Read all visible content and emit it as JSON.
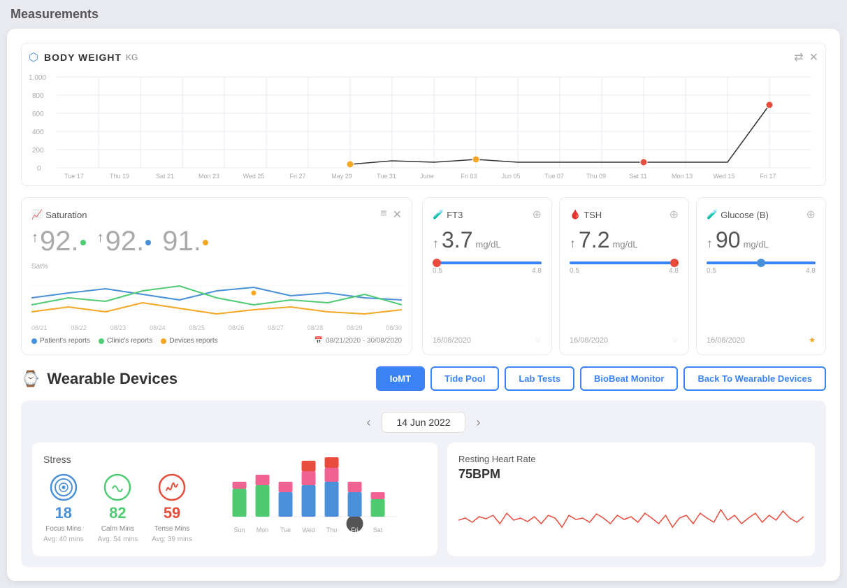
{
  "pageTitle": "Measurements",
  "bodyWeight": {
    "title": "BODY WEIGHT",
    "unit": "KG",
    "xLabels": [
      "Tue 17",
      "Thu 19",
      "Sat 21",
      "Mon 23",
      "Wed 25",
      "Fri 27",
      "May 29",
      "Tue 31",
      "June",
      "Fri 03",
      "Jun 05",
      "Tue 07",
      "Thu 09",
      "Sat 11",
      "Mon 13",
      "Wed 15",
      "Fri 17"
    ],
    "yLabels": [
      "1,000",
      "800",
      "600",
      "400",
      "200",
      "0"
    ]
  },
  "saturation": {
    "title": "Saturation",
    "values": [
      "92.",
      "92.",
      "91."
    ],
    "axisLabel": "Sat%",
    "legend": [
      {
        "label": "Patient's reports",
        "color": "#4a90d9"
      },
      {
        "label": "Clinic's reports",
        "color": "#4ecb71"
      },
      {
        "label": "Devices reports",
        "color": "#f5a623"
      }
    ],
    "dateRange": "08/21/2020 - 30/08/2020",
    "xLabels": [
      "08/21",
      "08/22",
      "08/23",
      "08/24",
      "08/25",
      "08/26",
      "08/27",
      "08/28",
      "08/29",
      "08/30"
    ]
  },
  "labCards": [
    {
      "id": "ft3",
      "icon": "🧪",
      "title": "FT3",
      "value": "3.7",
      "unit": "mg/dL",
      "sliderMin": "0.5",
      "sliderMax": "4.8",
      "thumbPos": "left",
      "date": "16/08/2020",
      "starred": false
    },
    {
      "id": "tsh",
      "icon": "🩸",
      "title": "TSH",
      "value": "7.2",
      "unit": "mg/dL",
      "sliderMin": "0.5",
      "sliderMax": "4.8",
      "thumbPos": "right",
      "date": "16/08/2020",
      "starred": false
    },
    {
      "id": "glucose",
      "icon": "🧪",
      "title": "Glucose (B)",
      "value": "90",
      "unit": "mg/dL",
      "sliderMin": "0.5",
      "sliderMax": "4.8",
      "thumbPos": "middle",
      "date": "16/08/2020",
      "starred": true
    }
  ],
  "wearable": {
    "sectionTitle": "Wearable Devices",
    "tabs": [
      {
        "id": "iomt",
        "label": "IoMT",
        "active": true
      },
      {
        "id": "tidepool",
        "label": "Tide Pool",
        "active": false
      },
      {
        "id": "labtests",
        "label": "Lab Tests",
        "active": false
      },
      {
        "id": "biobeat",
        "label": "BioBeat Monitor",
        "active": false
      },
      {
        "id": "back",
        "label": "Back To Wearable Devices",
        "active": false
      }
    ],
    "currentDate": "14 Jun 2022",
    "stress": {
      "title": "Stress",
      "metrics": [
        {
          "label": "Focus Mins",
          "value": "18",
          "avg": "Avg: 40 mins",
          "color": "#4a90d9",
          "iconType": "focus"
        },
        {
          "label": "Calm Mins",
          "value": "82",
          "avg": "Avg: 54 mins",
          "color": "#4ecb71",
          "iconType": "calm"
        },
        {
          "label": "Tense Mins",
          "value": "59",
          "avg": "Avg: 39 mins",
          "color": "#e74c3c",
          "iconType": "tense"
        }
      ],
      "barDays": [
        "Sun",
        "Mon",
        "Tue",
        "Wed",
        "Thu",
        "Fri",
        "Sat"
      ],
      "fridayHighlighted": true
    },
    "heartRate": {
      "title": "Resting Heart Rate",
      "value": "75BPM"
    }
  }
}
